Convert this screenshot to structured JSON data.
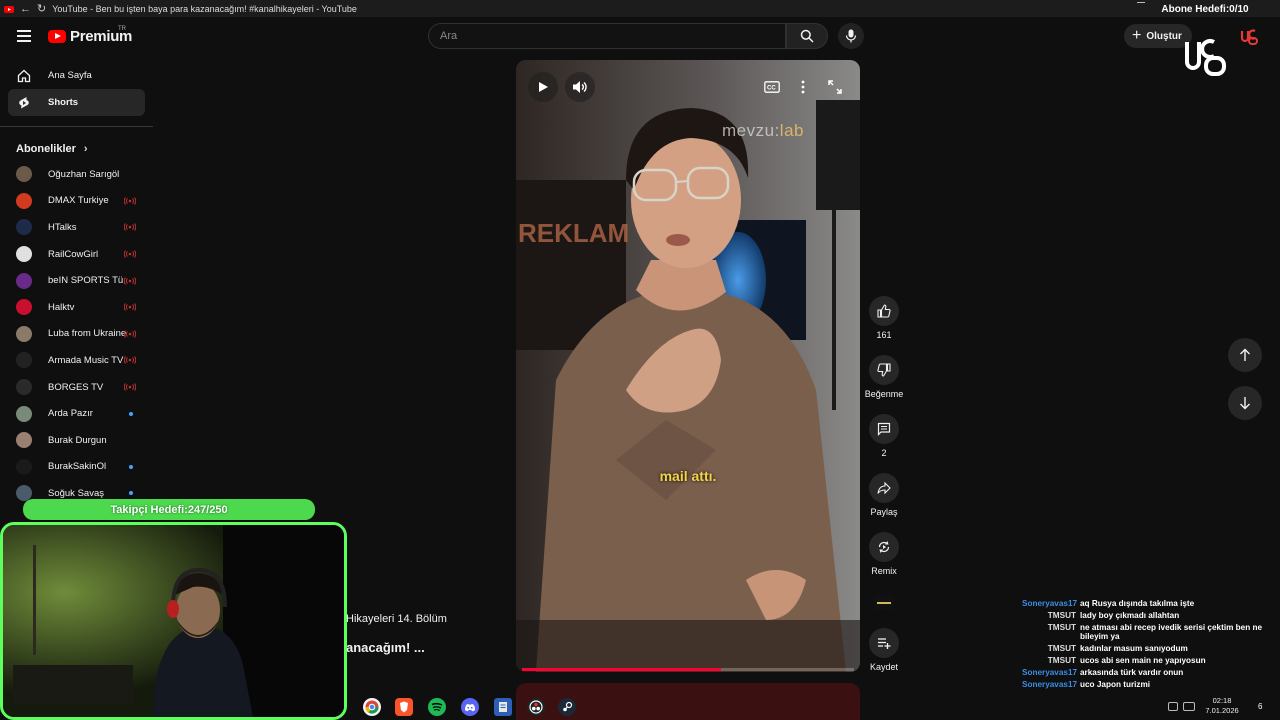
{
  "window": {
    "title": "YouTube - Ben bu işten baya para kazanacağım! #kanalhikayeleri - YouTube"
  },
  "header": {
    "logo_text": "Premium",
    "logo_sup": "TR",
    "search_placeholder": "Ara",
    "create_label": "Oluştur"
  },
  "sidebar": {
    "items": [
      {
        "label": "Ana Sayfa",
        "icon": "home-icon"
      },
      {
        "label": "Shorts",
        "icon": "shorts-icon",
        "active": true
      }
    ],
    "subscriptions_title": "Abonelikler",
    "subscriptions": [
      {
        "name": "Oğuzhan Sarıgöl",
        "status": "",
        "color": "#6b5a4a"
      },
      {
        "name": "DMAX Turkiye",
        "status": "live",
        "color": "#d23a20"
      },
      {
        "name": "HTalks",
        "status": "live",
        "color": "#1e2a4a"
      },
      {
        "name": "RailCowGirl",
        "status": "live",
        "color": "#e0e0e0"
      },
      {
        "name": "beIN SPORTS Tü...",
        "status": "live",
        "color": "#6a2a8a"
      },
      {
        "name": "Halktv",
        "status": "live",
        "color": "#c8102e"
      },
      {
        "name": "Luba from Ukraine",
        "status": "live",
        "color": "#8a7a6a"
      },
      {
        "name": "Armada Music TV",
        "status": "live",
        "color": "#222222"
      },
      {
        "name": "BORGES TV",
        "status": "live",
        "color": "#2a2a2a"
      },
      {
        "name": "Arda Pazır",
        "status": "new",
        "color": "#7a8a7a"
      },
      {
        "name": "Burak Durgun",
        "status": "",
        "color": "#9a8070"
      },
      {
        "name": "BurakSakinOl",
        "status": "new",
        "color": "#1a1a1a"
      },
      {
        "name": "Soğuk Savaş",
        "status": "new",
        "color": "#4a5a6a"
      }
    ]
  },
  "player": {
    "watermark_main": "mevzu:",
    "watermark_accent": "lab",
    "caption": "mail attı.",
    "progress": 0.6
  },
  "actions": {
    "like_count": "161",
    "dislike_label": "Beğenme",
    "comment_count": "2",
    "share_label": "Paylaş",
    "remix_label": "Remix",
    "save_label": "Kaydet"
  },
  "background_titles": {
    "line1": "Hikayeleri 14. Bölüm",
    "line2": "anacağım! ..."
  },
  "overlay": {
    "follower_goal": "Takipçi Hedefi:247/250",
    "subscriber_goal": "Abone Hedefi:0/10"
  },
  "chat": [
    {
      "user": "Soneryavas17",
      "msg": "aq Rusya dışında takılma işte",
      "color": "#3a8ee6"
    },
    {
      "user": "TMSUT",
      "msg": "lady boy çıkmadı allahtan",
      "color": "#dddddd"
    },
    {
      "user": "TMSUT",
      "msg": "ne atması abi recep ivedik serisi çektim ben ne bileyim ya",
      "color": "#dddddd"
    },
    {
      "user": "TMSUT",
      "msg": "kadınlar masum sanıyodum",
      "color": "#dddddd"
    },
    {
      "user": "TMSUT",
      "msg": "ucos abi sen main ne yapıyosun",
      "color": "#dddddd"
    },
    {
      "user": "Soneryavas17",
      "msg": "arkasında türk vardır onun",
      "color": "#3a8ee6"
    },
    {
      "user": "Soneryavas17",
      "msg": "uco Japon turizmi",
      "color": "#3a8ee6"
    }
  ],
  "taskbar": {
    "time": "02:18",
    "date": "7.01.2026",
    "notifications": "6"
  }
}
